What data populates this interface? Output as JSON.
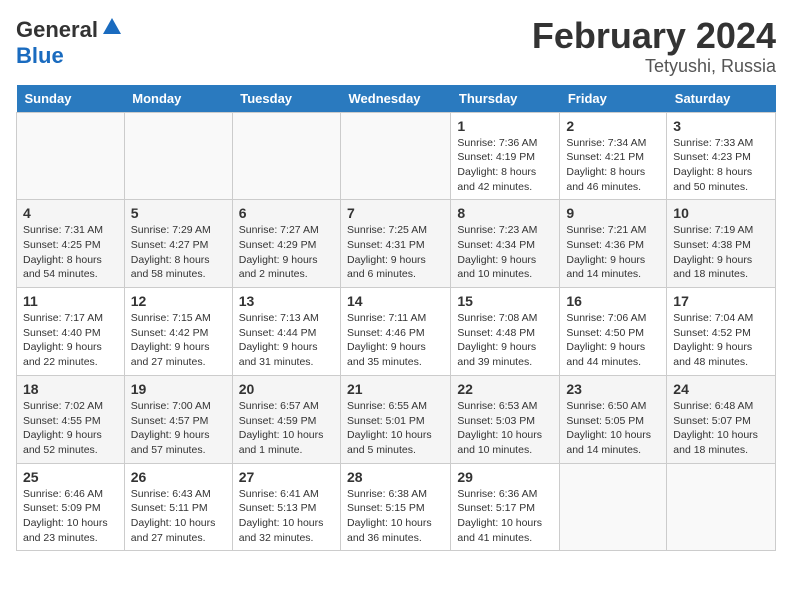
{
  "header": {
    "logo_general": "General",
    "logo_blue": "Blue",
    "month_year": "February 2024",
    "location": "Tetyushi, Russia"
  },
  "calendar": {
    "days_of_week": [
      "Sunday",
      "Monday",
      "Tuesday",
      "Wednesday",
      "Thursday",
      "Friday",
      "Saturday"
    ],
    "weeks": [
      [
        {
          "day": "",
          "info": ""
        },
        {
          "day": "",
          "info": ""
        },
        {
          "day": "",
          "info": ""
        },
        {
          "day": "",
          "info": ""
        },
        {
          "day": "1",
          "info": "Sunrise: 7:36 AM\nSunset: 4:19 PM\nDaylight: 8 hours\nand 42 minutes."
        },
        {
          "day": "2",
          "info": "Sunrise: 7:34 AM\nSunset: 4:21 PM\nDaylight: 8 hours\nand 46 minutes."
        },
        {
          "day": "3",
          "info": "Sunrise: 7:33 AM\nSunset: 4:23 PM\nDaylight: 8 hours\nand 50 minutes."
        }
      ],
      [
        {
          "day": "4",
          "info": "Sunrise: 7:31 AM\nSunset: 4:25 PM\nDaylight: 8 hours\nand 54 minutes."
        },
        {
          "day": "5",
          "info": "Sunrise: 7:29 AM\nSunset: 4:27 PM\nDaylight: 8 hours\nand 58 minutes."
        },
        {
          "day": "6",
          "info": "Sunrise: 7:27 AM\nSunset: 4:29 PM\nDaylight: 9 hours\nand 2 minutes."
        },
        {
          "day": "7",
          "info": "Sunrise: 7:25 AM\nSunset: 4:31 PM\nDaylight: 9 hours\nand 6 minutes."
        },
        {
          "day": "8",
          "info": "Sunrise: 7:23 AM\nSunset: 4:34 PM\nDaylight: 9 hours\nand 10 minutes."
        },
        {
          "day": "9",
          "info": "Sunrise: 7:21 AM\nSunset: 4:36 PM\nDaylight: 9 hours\nand 14 minutes."
        },
        {
          "day": "10",
          "info": "Sunrise: 7:19 AM\nSunset: 4:38 PM\nDaylight: 9 hours\nand 18 minutes."
        }
      ],
      [
        {
          "day": "11",
          "info": "Sunrise: 7:17 AM\nSunset: 4:40 PM\nDaylight: 9 hours\nand 22 minutes."
        },
        {
          "day": "12",
          "info": "Sunrise: 7:15 AM\nSunset: 4:42 PM\nDaylight: 9 hours\nand 27 minutes."
        },
        {
          "day": "13",
          "info": "Sunrise: 7:13 AM\nSunset: 4:44 PM\nDaylight: 9 hours\nand 31 minutes."
        },
        {
          "day": "14",
          "info": "Sunrise: 7:11 AM\nSunset: 4:46 PM\nDaylight: 9 hours\nand 35 minutes."
        },
        {
          "day": "15",
          "info": "Sunrise: 7:08 AM\nSunset: 4:48 PM\nDaylight: 9 hours\nand 39 minutes."
        },
        {
          "day": "16",
          "info": "Sunrise: 7:06 AM\nSunset: 4:50 PM\nDaylight: 9 hours\nand 44 minutes."
        },
        {
          "day": "17",
          "info": "Sunrise: 7:04 AM\nSunset: 4:52 PM\nDaylight: 9 hours\nand 48 minutes."
        }
      ],
      [
        {
          "day": "18",
          "info": "Sunrise: 7:02 AM\nSunset: 4:55 PM\nDaylight: 9 hours\nand 52 minutes."
        },
        {
          "day": "19",
          "info": "Sunrise: 7:00 AM\nSunset: 4:57 PM\nDaylight: 9 hours\nand 57 minutes."
        },
        {
          "day": "20",
          "info": "Sunrise: 6:57 AM\nSunset: 4:59 PM\nDaylight: 10 hours\nand 1 minute."
        },
        {
          "day": "21",
          "info": "Sunrise: 6:55 AM\nSunset: 5:01 PM\nDaylight: 10 hours\nand 5 minutes."
        },
        {
          "day": "22",
          "info": "Sunrise: 6:53 AM\nSunset: 5:03 PM\nDaylight: 10 hours\nand 10 minutes."
        },
        {
          "day": "23",
          "info": "Sunrise: 6:50 AM\nSunset: 5:05 PM\nDaylight: 10 hours\nand 14 minutes."
        },
        {
          "day": "24",
          "info": "Sunrise: 6:48 AM\nSunset: 5:07 PM\nDaylight: 10 hours\nand 18 minutes."
        }
      ],
      [
        {
          "day": "25",
          "info": "Sunrise: 6:46 AM\nSunset: 5:09 PM\nDaylight: 10 hours\nand 23 minutes."
        },
        {
          "day": "26",
          "info": "Sunrise: 6:43 AM\nSunset: 5:11 PM\nDaylight: 10 hours\nand 27 minutes."
        },
        {
          "day": "27",
          "info": "Sunrise: 6:41 AM\nSunset: 5:13 PM\nDaylight: 10 hours\nand 32 minutes."
        },
        {
          "day": "28",
          "info": "Sunrise: 6:38 AM\nSunset: 5:15 PM\nDaylight: 10 hours\nand 36 minutes."
        },
        {
          "day": "29",
          "info": "Sunrise: 6:36 AM\nSunset: 5:17 PM\nDaylight: 10 hours\nand 41 minutes."
        },
        {
          "day": "",
          "info": ""
        },
        {
          "day": "",
          "info": ""
        }
      ]
    ]
  }
}
